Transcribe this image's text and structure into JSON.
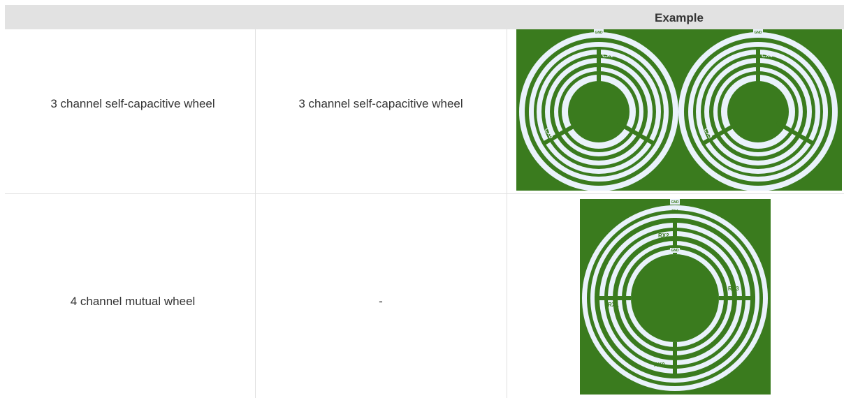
{
  "table": {
    "header": {
      "example": "Example"
    },
    "rows": [
      {
        "name": "3 channel self-capacitive wheel",
        "description": "3 channel self-capacitive wheel",
        "example_image": {
          "wheels": [
            {
              "gnd": "GND",
              "labels": [
                "CX1",
                "CX0",
                "CX2"
              ]
            },
            {
              "gnd": "GND",
              "labels": [
                "CX4",
                "CX3",
                "CX5"
              ]
            }
          ]
        }
      },
      {
        "name": "4 channel mutual wheel",
        "description": "-",
        "example_image": {
          "gnd_outer": "GND",
          "gnd_inner": "GND",
          "labels": [
            "TX4",
            "RX2",
            "RX3",
            "RX1",
            "RX0"
          ]
        }
      }
    ]
  },
  "colors": {
    "pcb_green": "#3a7b1e",
    "pad_fill": "#eaf2fb",
    "header_bg": "#e2e2e2"
  }
}
